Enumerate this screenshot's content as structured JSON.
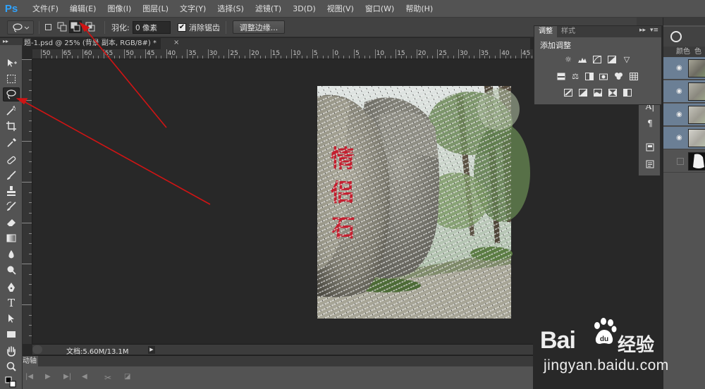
{
  "app": {
    "logo": "Ps"
  },
  "menu": [
    "文件(F)",
    "编辑(E)",
    "图像(I)",
    "图层(L)",
    "文字(Y)",
    "选择(S)",
    "滤镜(T)",
    "3D(D)",
    "视图(V)",
    "窗口(W)",
    "帮助(H)"
  ],
  "options": {
    "feather_label": "羽化:",
    "feather_value": "0 像素",
    "antialias_label": "消除锯齿",
    "antialias_checked": "✔",
    "refine_edge": "调整边缘..."
  },
  "document": {
    "tab_title": "题-1.psd @ 25% (背景 副本, RGB/8#) *",
    "close": "×"
  },
  "ruler": {
    "top": [
      "50",
      "65",
      "60",
      "55",
      "50",
      "45",
      "40",
      "35",
      "30",
      "25",
      "20",
      "15",
      "10",
      "5",
      "0",
      "5",
      "10",
      "15",
      "20",
      "25",
      "30",
      "35",
      "40",
      "45"
    ]
  },
  "canvas_text": "情侣石",
  "status": {
    "doc": "文档:5.60M/13.1M"
  },
  "timeline": {
    "tab": "动轴"
  },
  "adjustments": {
    "tab_adjust": "调整",
    "tab_style": "样式",
    "title": "添加调整",
    "collapse": "▸▸",
    "menu": "▾≡"
  },
  "layers": {
    "tabs": [
      "颜色",
      "色"
    ],
    "rows": [
      {
        "visible": true,
        "selected": true
      },
      {
        "visible": true,
        "selected": true
      },
      {
        "visible": true,
        "selected": true
      },
      {
        "visible": true,
        "selected": true
      },
      {
        "visible": false,
        "selected": false
      }
    ]
  },
  "watermark": {
    "brand": "Bai",
    "brand_suffix": "du",
    "jingyan": "经验",
    "url": "jingyan.baidu.com"
  },
  "colors": {
    "ps_blue": "#2fa3ff",
    "selection_blue": "#6b7f95",
    "arrow_red": "#d01414",
    "text_red": "#c41e2e"
  }
}
